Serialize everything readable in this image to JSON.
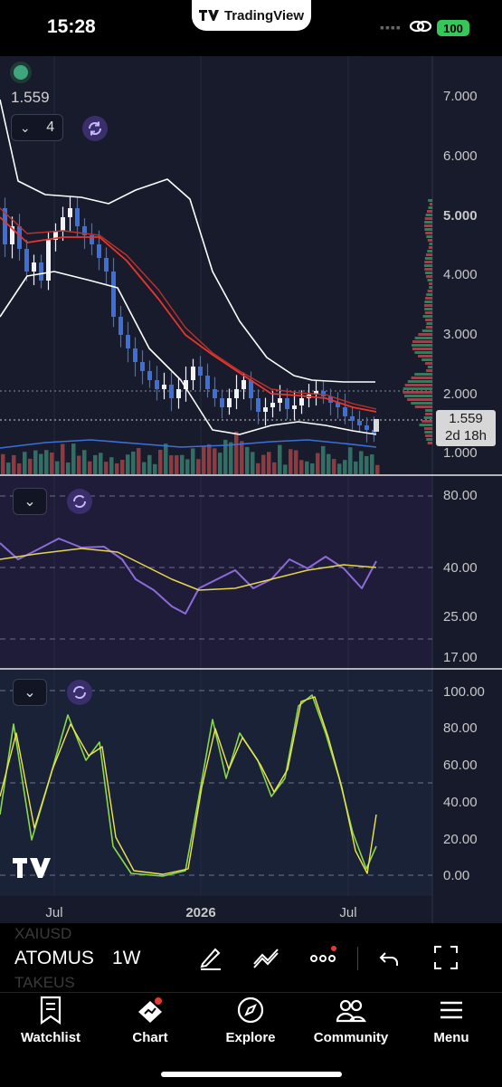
{
  "status_bar": {
    "time": "15:28",
    "app_name": "TradingView",
    "battery": "100"
  },
  "chart": {
    "current_price_top": "1.559",
    "indicator_count": "4",
    "price_axis": [
      "7.000",
      "6.000",
      "5.000",
      "4.000",
      "3.000",
      "2.000",
      "1.000"
    ],
    "price_label": {
      "price": "1.559",
      "countdown": "2d 18h"
    },
    "rsi_axis": [
      "80.00",
      "40.00",
      "25.00",
      "17.00"
    ],
    "stoch_axis": [
      "100.00",
      "80.00",
      "60.00",
      "40.00",
      "20.00",
      "0.00"
    ],
    "time_axis": [
      "Jul",
      "2026",
      "Jul"
    ]
  },
  "ticker": {
    "symbol": "ATOMUS",
    "interval": "1W",
    "ghost_above": "XAIUSD",
    "ghost_below": "TAKEUS"
  },
  "tabs": [
    {
      "label": "Watchlist",
      "icon": "watchlist-icon"
    },
    {
      "label": "Chart",
      "icon": "chart-icon"
    },
    {
      "label": "Explore",
      "icon": "compass-icon"
    },
    {
      "label": "Community",
      "icon": "community-icon"
    },
    {
      "label": "Menu",
      "icon": "menu-icon"
    }
  ],
  "colors": {
    "background": "#161a2a",
    "up": "#f2f2f2",
    "down": "#3d6fd8",
    "ema": "#e8362c",
    "bands": "#ffffff",
    "rsi": "#8c6ad8",
    "rsi_ma": "#e6d44c",
    "stoch_k": "#86d94a",
    "stoch_d": "#f0e44a"
  }
}
